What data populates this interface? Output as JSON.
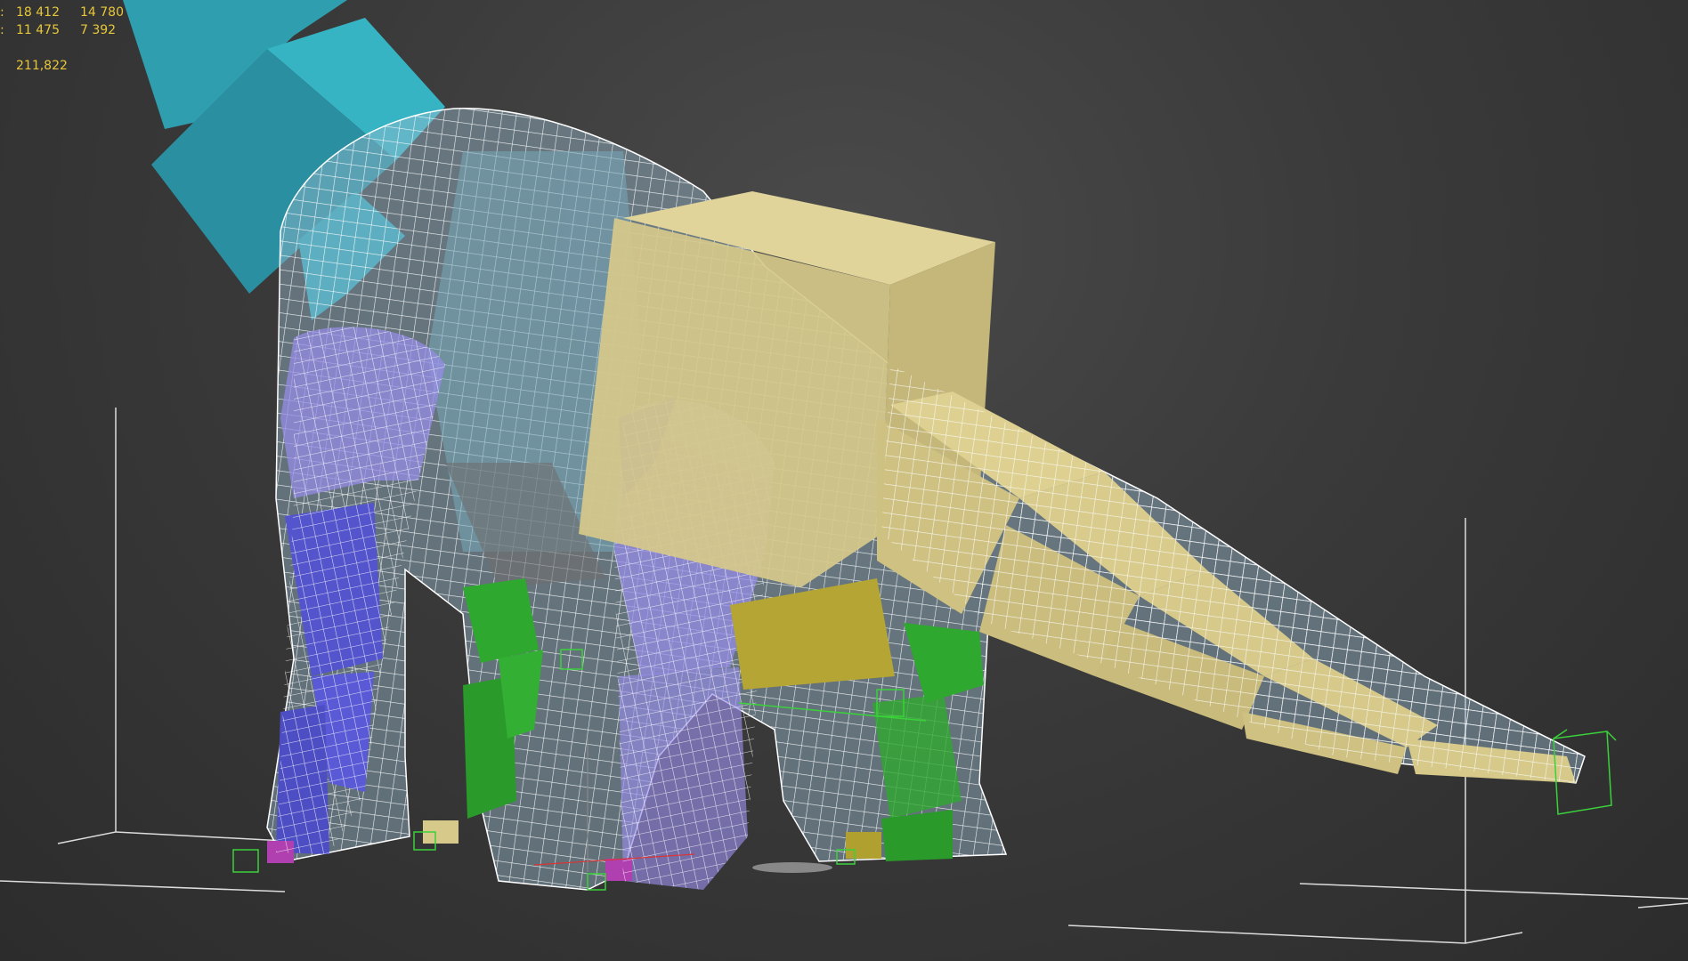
{
  "viewport": {
    "stats": {
      "rows": [
        {
          "label": ":",
          "value_a": "18 412",
          "value_b": "14 780"
        },
        {
          "label": ":",
          "value_a": "11 475",
          "value_b": "7 392"
        }
      ],
      "total": "211,822"
    }
  },
  "colors": {
    "background": "#3a3a3a",
    "wireframe": "#ffffff",
    "neck_boxes": "#2f9fb0",
    "pelvis_tail_boxes": "#d6c98a",
    "front_leg_boxes": "#5a5ad6",
    "rear_leg_boxes": "#2fa82f",
    "foot_helpers": "#b040b0",
    "ik_helpers": "#3bd13b",
    "stats_text": "#e7c73a"
  }
}
